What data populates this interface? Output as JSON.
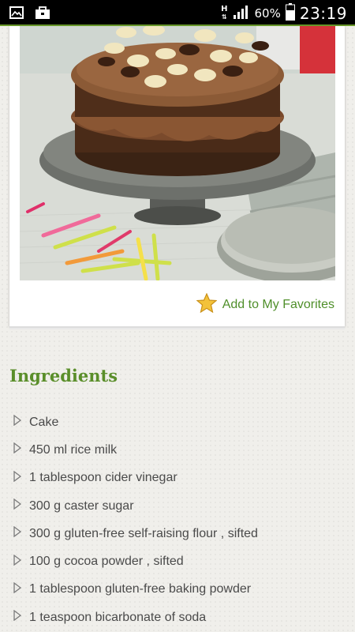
{
  "status_bar": {
    "network_type": "H",
    "battery_percent": "60%",
    "time": "23:19",
    "icons": [
      "gallery-icon",
      "briefcase-icon",
      "network-arrows-icon",
      "signal-icon",
      "battery-icon"
    ]
  },
  "recipe_card": {
    "favorite_label": "Add to My Favorites",
    "favorite_icon": "star-icon"
  },
  "ingredients": {
    "title": "Ingredients",
    "items": [
      "Cake",
      "450 ml rice milk",
      "1 tablespoon cider vinegar",
      "300 g caster sugar",
      "300 g gluten-free self-raising flour , sifted",
      "100 g cocoa powder , sifted",
      "1 tablespoon gluten-free baking powder",
      "1 teaspoon bicarbonate of soda"
    ]
  },
  "colors": {
    "accent_green": "#5a8e2a",
    "status_bar": "#000000",
    "text": "#4a4a4a"
  }
}
